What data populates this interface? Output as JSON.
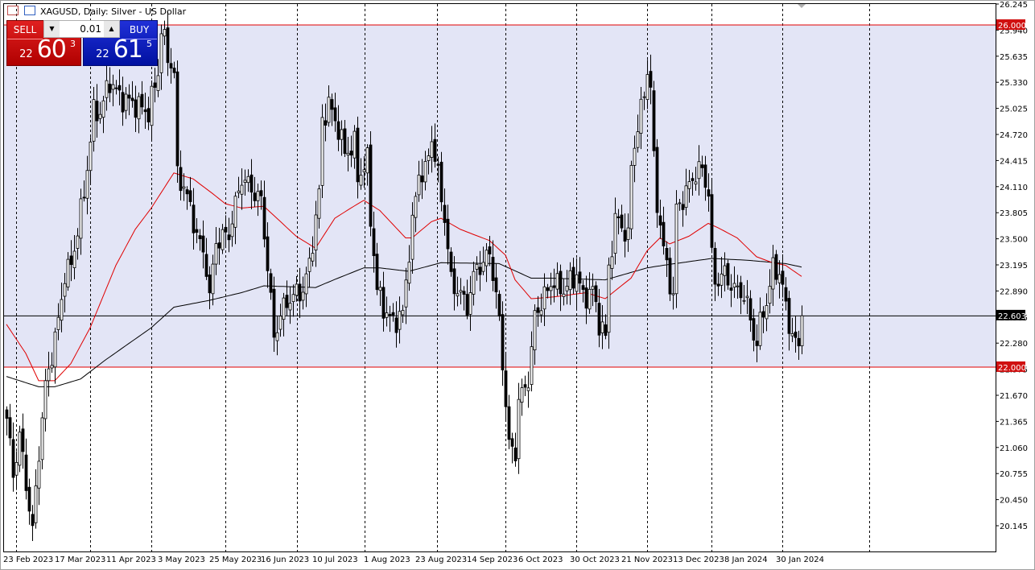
{
  "header": {
    "title": "XAGUSD, Daily:  Silver - US Dollar"
  },
  "trade_panel": {
    "sell_label": "SELL",
    "buy_label": "BUY",
    "lot": "0.01",
    "sell_price": {
      "small": "22",
      "large": "60",
      "pip": "3"
    },
    "buy_price": {
      "small": "22",
      "large": "61",
      "pip": "5"
    }
  },
  "colors": {
    "band": "#e3e5f6",
    "level_line": "#e00000",
    "ma_fast": "#e00000",
    "ma_slow": "#000000",
    "bid_label_bg": "#000000",
    "level_label_bg": "#d01010"
  },
  "chart_data": {
    "type": "candlestick",
    "symbol": "XAGUSD",
    "timeframe": "Daily",
    "ylim": [
      20.145,
      26.245
    ],
    "y_ticks": [
      "26.245",
      "25.940",
      "25.635",
      "25.330",
      "25.025",
      "24.720",
      "24.415",
      "24.110",
      "23.805",
      "23.500",
      "23.195",
      "22.890",
      "22.585",
      "22.280",
      "21.975",
      "21.670",
      "21.365",
      "21.060",
      "20.755",
      "20.450",
      "20.145"
    ],
    "x_ticks": [
      "23 Feb 2023",
      "17 Mar 2023",
      "11 Apr 2023",
      "3 May 2023",
      "25 May 2023",
      "16 Jun 2023",
      "10 Jul 2023",
      "1 Aug 2023",
      "23 Aug 2023",
      "14 Sep 2023",
      "6 Oct 2023",
      "30 Oct 2023",
      "21 Nov 2023",
      "13 Dec 2023",
      "8 Jan 2024",
      "30 Jan 2024"
    ],
    "bar_count": 248,
    "close_path": [
      [
        0,
        21.4
      ],
      [
        2,
        20.74
      ],
      [
        4,
        21.2
      ],
      [
        8,
        20.08
      ],
      [
        10,
        21.02
      ],
      [
        12,
        21.77
      ],
      [
        16,
        22.53
      ],
      [
        18,
        23.09
      ],
      [
        20,
        23.19
      ],
      [
        24,
        24.03
      ],
      [
        27,
        24.98
      ],
      [
        29,
        24.98
      ],
      [
        32,
        25.35
      ],
      [
        35,
        25.16
      ],
      [
        40,
        25.07
      ],
      [
        44,
        24.98
      ],
      [
        47,
        25.45
      ],
      [
        48,
        25.96
      ],
      [
        50,
        25.63
      ],
      [
        52,
        25.45
      ],
      [
        53,
        24.22
      ],
      [
        55,
        24.13
      ],
      [
        59,
        23.56
      ],
      [
        62,
        23.19
      ],
      [
        63,
        22.81
      ],
      [
        65,
        23.47
      ],
      [
        69,
        23.56
      ],
      [
        73,
        24.22
      ],
      [
        75,
        24.13
      ],
      [
        79,
        23.94
      ],
      [
        81,
        23.19
      ],
      [
        83,
        22.34
      ],
      [
        85,
        22.62
      ],
      [
        88,
        22.81
      ],
      [
        92,
        22.9
      ],
      [
        94,
        23.19
      ],
      [
        97,
        24.03
      ],
      [
        98,
        24.88
      ],
      [
        100,
        25.07
      ],
      [
        103,
        24.79
      ],
      [
        105,
        24.5
      ],
      [
        108,
        24.6
      ],
      [
        109,
        24.22
      ],
      [
        112,
        24.41
      ],
      [
        113,
        23.75
      ],
      [
        115,
        22.9
      ],
      [
        118,
        22.62
      ],
      [
        120,
        22.53
      ],
      [
        123,
        22.62
      ],
      [
        125,
        23.37
      ],
      [
        128,
        24.27
      ],
      [
        130,
        24.27
      ],
      [
        132,
        24.69
      ],
      [
        134,
        24.22
      ],
      [
        136,
        23.75
      ],
      [
        138,
        23.0
      ],
      [
        140,
        22.9
      ],
      [
        143,
        22.72
      ],
      [
        146,
        23.19
      ],
      [
        148,
        23.19
      ],
      [
        150,
        23.37
      ],
      [
        152,
        22.81
      ],
      [
        153,
        22.53
      ],
      [
        154,
        22.06
      ],
      [
        156,
        21.07
      ],
      [
        158,
        21.02
      ],
      [
        159,
        21.59
      ],
      [
        162,
        21.87
      ],
      [
        163,
        22.15
      ],
      [
        164,
        22.62
      ],
      [
        167,
        22.81
      ],
      [
        169,
        23.0
      ],
      [
        173,
        22.9
      ],
      [
        177,
        23.09
      ],
      [
        179,
        22.81
      ],
      [
        182,
        22.9
      ],
      [
        184,
        22.53
      ],
      [
        186,
        22.34
      ],
      [
        187,
        23.19
      ],
      [
        189,
        23.66
      ],
      [
        190,
        23.75
      ],
      [
        193,
        23.47
      ],
      [
        194,
        24.41
      ],
      [
        197,
        24.98
      ],
      [
        198,
        25.26
      ],
      [
        199,
        25.45
      ],
      [
        200,
        25.26
      ],
      [
        201,
        24.41
      ],
      [
        202,
        23.94
      ],
      [
        204,
        23.37
      ],
      [
        206,
        23.0
      ],
      [
        207,
        22.81
      ],
      [
        208,
        23.85
      ],
      [
        211,
        24.03
      ],
      [
        213,
        24.22
      ],
      [
        216,
        24.32
      ],
      [
        218,
        24.03
      ],
      [
        219,
        23.28
      ],
      [
        220,
        23.0
      ],
      [
        223,
        23.09
      ],
      [
        226,
        22.9
      ],
      [
        228,
        22.9
      ],
      [
        230,
        22.72
      ],
      [
        233,
        22.24
      ],
      [
        234,
        22.53
      ],
      [
        237,
        22.9
      ],
      [
        238,
        23.19
      ],
      [
        240,
        23.09
      ],
      [
        242,
        22.72
      ],
      [
        244,
        22.34
      ],
      [
        246,
        22.24
      ],
      [
        247,
        22.6
      ]
    ],
    "ma_fast": [
      [
        0,
        22.5
      ],
      [
        6,
        22.16
      ],
      [
        10,
        21.84
      ],
      [
        15,
        21.84
      ],
      [
        20,
        22.04
      ],
      [
        26,
        22.46
      ],
      [
        34,
        23.19
      ],
      [
        40,
        23.61
      ],
      [
        45,
        23.86
      ],
      [
        52,
        24.27
      ],
      [
        58,
        24.2
      ],
      [
        64,
        24.03
      ],
      [
        68,
        23.91
      ],
      [
        73,
        23.86
      ],
      [
        80,
        23.88
      ],
      [
        90,
        23.53
      ],
      [
        96,
        23.39
      ],
      [
        102,
        23.74
      ],
      [
        107,
        23.86
      ],
      [
        111,
        23.95
      ],
      [
        116,
        23.83
      ],
      [
        124,
        23.51
      ],
      [
        126,
        23.51
      ],
      [
        132,
        23.7
      ],
      [
        135,
        23.74
      ],
      [
        141,
        23.61
      ],
      [
        150,
        23.48
      ],
      [
        155,
        23.31
      ],
      [
        158,
        23.02
      ],
      [
        163,
        22.8
      ],
      [
        170,
        22.82
      ],
      [
        180,
        22.87
      ],
      [
        186,
        22.8
      ],
      [
        194,
        23.04
      ],
      [
        199,
        23.36
      ],
      [
        203,
        23.51
      ],
      [
        206,
        23.44
      ],
      [
        212,
        23.53
      ],
      [
        218,
        23.68
      ],
      [
        221,
        23.63
      ],
      [
        227,
        23.51
      ],
      [
        233,
        23.29
      ],
      [
        238,
        23.22
      ],
      [
        242,
        23.19
      ],
      [
        247,
        23.06
      ]
    ],
    "ma_slow": [
      [
        0,
        21.89
      ],
      [
        10,
        21.77
      ],
      [
        15,
        21.77
      ],
      [
        23,
        21.86
      ],
      [
        31,
        22.09
      ],
      [
        45,
        22.46
      ],
      [
        52,
        22.7
      ],
      [
        63,
        22.78
      ],
      [
        73,
        22.87
      ],
      [
        80,
        22.95
      ],
      [
        96,
        22.93
      ],
      [
        103,
        23.04
      ],
      [
        111,
        23.16
      ],
      [
        116,
        23.16
      ],
      [
        125,
        23.12
      ],
      [
        135,
        23.22
      ],
      [
        153,
        23.21
      ],
      [
        163,
        23.04
      ],
      [
        169,
        23.04
      ],
      [
        186,
        23.02
      ],
      [
        199,
        23.16
      ],
      [
        204,
        23.19
      ],
      [
        219,
        23.27
      ],
      [
        230,
        23.25
      ],
      [
        242,
        23.21
      ],
      [
        247,
        23.17
      ]
    ],
    "levels": [
      {
        "price": 26.0,
        "label": "26.000"
      },
      {
        "price": 22.0,
        "label": "22.000"
      }
    ],
    "bid": {
      "price": 22.603,
      "label": "22.603"
    }
  }
}
